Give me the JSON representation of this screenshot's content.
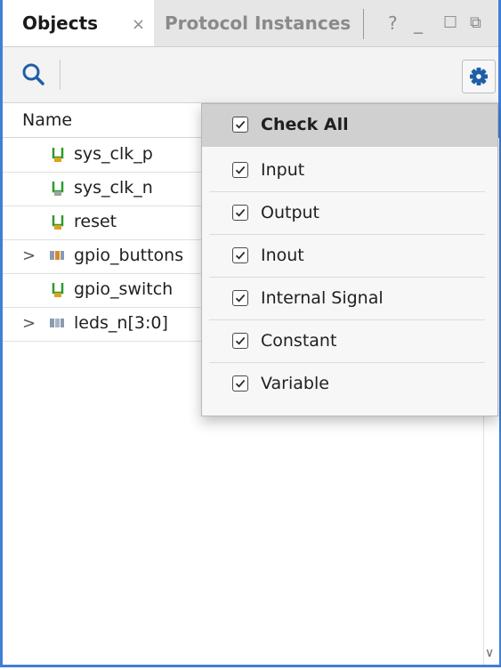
{
  "tabs": {
    "active_label": "Objects",
    "close_glyph": "×",
    "inactive_label": "Protocol Instances"
  },
  "window_buttons": {
    "help": "?",
    "minimize": "_",
    "maximize": "☐",
    "restore": "⧉"
  },
  "toolbar": {
    "search_icon": "search-icon",
    "settings_icon": "gear-icon"
  },
  "tree": {
    "column_header": "Name",
    "rows": [
      {
        "label": "sys_clk_p",
        "kind": "signal",
        "icon_color": "#2e9b2e",
        "expandable": false
      },
      {
        "label": "sys_clk_n",
        "kind": "signal",
        "icon_color": "#7a8a7a",
        "expandable": false
      },
      {
        "label": "reset",
        "kind": "signal",
        "icon_color": "#2e9b2e",
        "expandable": false
      },
      {
        "label": "gpio_buttons",
        "kind": "bus",
        "icon_color": "#d88a2a",
        "expandable": true
      },
      {
        "label": "gpio_switch",
        "kind": "signal",
        "icon_color": "#2e9b2e",
        "expandable": false
      },
      {
        "label": "leds_n[3:0]",
        "kind": "bus",
        "icon_color": "#7a8aa0",
        "expandable": true
      }
    ]
  },
  "menu": {
    "check_all": {
      "label": "Check All",
      "checked": true
    },
    "items": [
      {
        "label": "Input",
        "checked": true
      },
      {
        "label": "Output",
        "checked": true
      },
      {
        "label": "Inout",
        "checked": true
      },
      {
        "label": "Internal Signal",
        "checked": true
      },
      {
        "label": "Constant",
        "checked": true
      },
      {
        "label": "Variable",
        "checked": true
      }
    ]
  },
  "colors": {
    "frame_border": "#3f7fd6",
    "tab_bar": "#e6e6e6",
    "menu_header": "#d0d0d0"
  }
}
